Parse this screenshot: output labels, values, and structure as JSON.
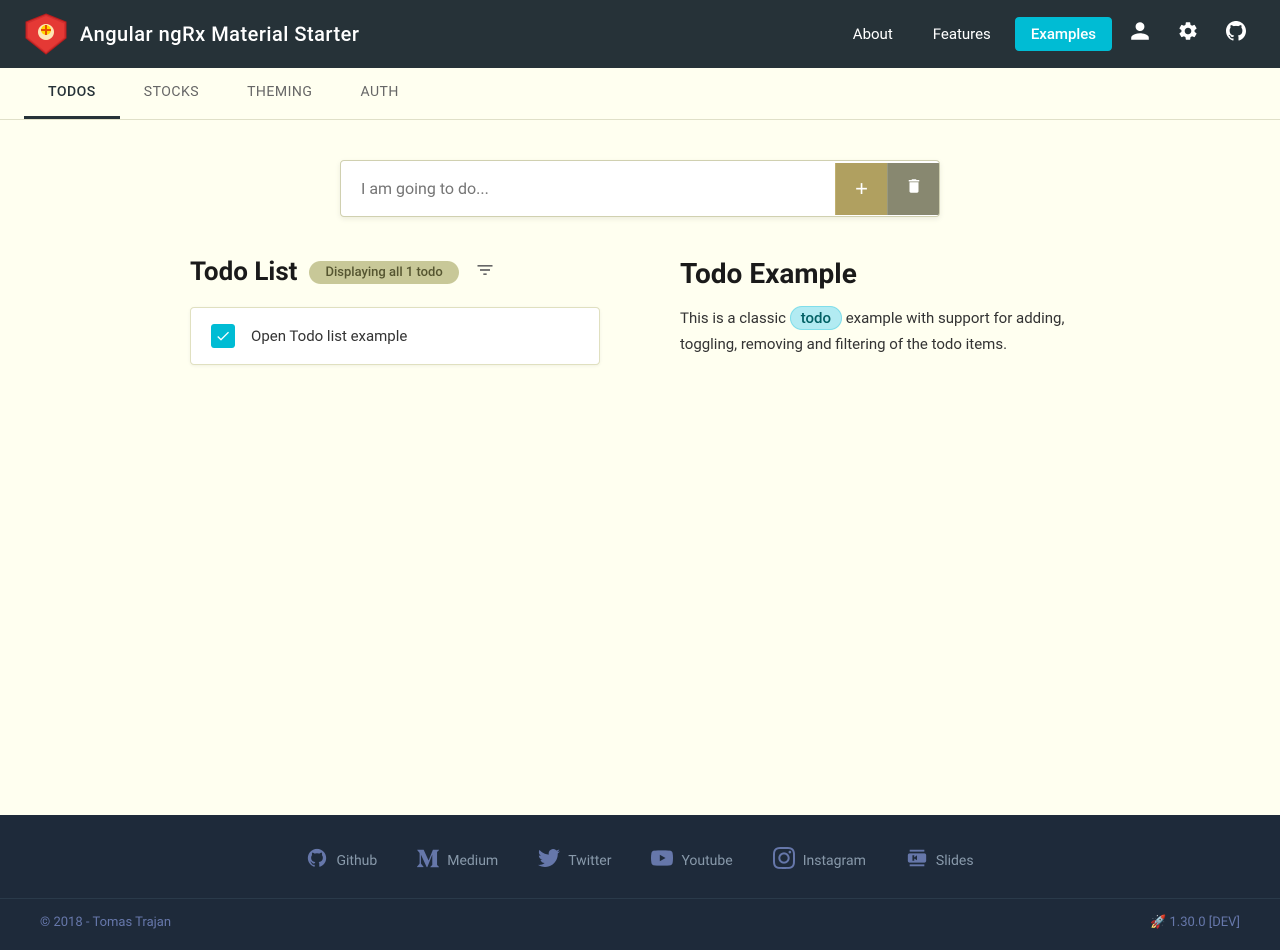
{
  "header": {
    "app_title": "Angular ngRx Material Starter",
    "nav": [
      {
        "label": "About",
        "active": false
      },
      {
        "label": "Features",
        "active": false
      },
      {
        "label": "Examples",
        "active": true
      }
    ],
    "icons": [
      "person-icon",
      "settings-icon",
      "github-icon"
    ]
  },
  "tabs": [
    {
      "label": "Todos",
      "active": true
    },
    {
      "label": "Stocks",
      "active": false
    },
    {
      "label": "Theming",
      "active": false
    },
    {
      "label": "Auth",
      "active": false
    }
  ],
  "todo_input": {
    "placeholder": "I am going to do...",
    "add_label": "+",
    "clear_label": "✕"
  },
  "todo_list": {
    "title": "Todo List",
    "badge": "Displaying all 1 todo",
    "items": [
      {
        "text": "Open Todo list example",
        "checked": true
      }
    ]
  },
  "todo_example": {
    "title": "Todo Example",
    "description_parts": [
      "This is a classic ",
      "todo",
      " example with support for adding, toggling, removing and filtering of the todo items."
    ]
  },
  "footer": {
    "links": [
      {
        "label": "Github",
        "icon": "github"
      },
      {
        "label": "Medium",
        "icon": "medium"
      },
      {
        "label": "Twitter",
        "icon": "twitter"
      },
      {
        "label": "Youtube",
        "icon": "youtube"
      },
      {
        "label": "Instagram",
        "icon": "instagram"
      },
      {
        "label": "Slides",
        "icon": "slides"
      }
    ],
    "copyright": "© 2018 - Tomas Trajan",
    "version": "🚀 1.30.0 [DEV]"
  },
  "colors": {
    "header_bg": "#263238",
    "accent": "#00bcd4",
    "main_bg": "#fffff0",
    "footer_bg": "#1e2a3a"
  }
}
